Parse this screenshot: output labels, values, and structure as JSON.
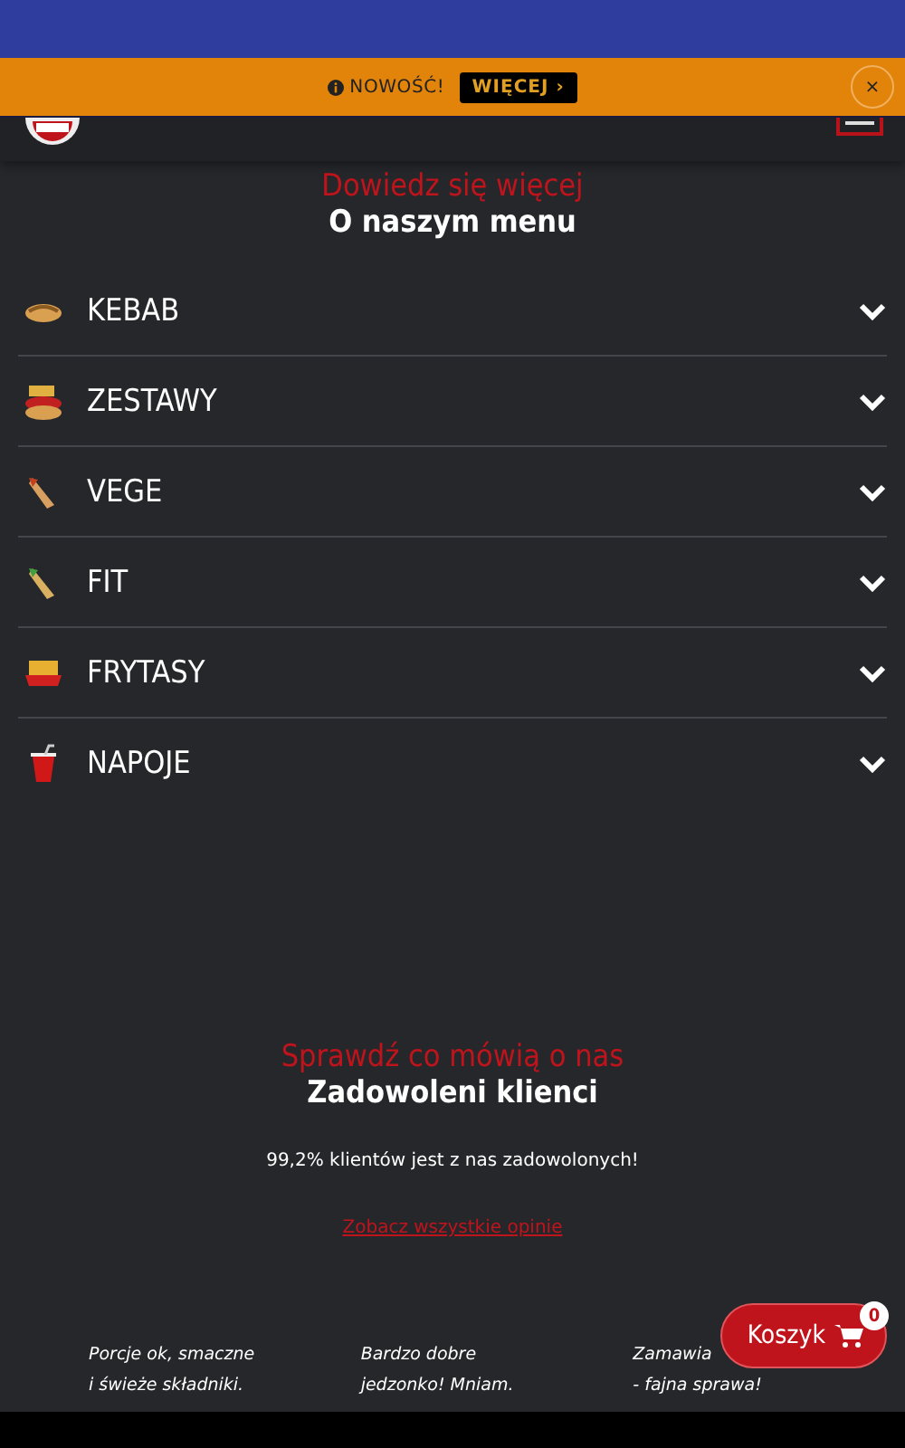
{
  "banner": {
    "label": "NOWOŚĆ!",
    "button": "WIĘCEJ ›",
    "close": "×"
  },
  "menu_section": {
    "subtitle": "Dowiedz się więcej",
    "title": "O naszym menu",
    "items": [
      {
        "label": "KEBAB",
        "kind": "kebab",
        "expanded": false
      },
      {
        "label": "ZESTAWY",
        "kind": "set",
        "expanded": false
      },
      {
        "label": "VEGE",
        "kind": "wrap",
        "expanded": false
      },
      {
        "label": "FIT",
        "kind": "wrapgreen",
        "expanded": false
      },
      {
        "label": "FRYTASY",
        "kind": "fries",
        "expanded": false
      },
      {
        "label": "NAPOJE",
        "kind": "drink",
        "expanded": false
      }
    ]
  },
  "reviews_section": {
    "subtitle": "Sprawdź co mówią o nas",
    "title": "Zadowoleni klienci",
    "summary": "99,2% klientów jest z nas zadowolonych!",
    "link": "Zobacz wszystkie opinie",
    "reviews": [
      [
        "Porcje ok, smaczne",
        "i świeże składniki."
      ],
      [
        "Bardzo dobre",
        "jedzonko! Mniam."
      ],
      [
        "Zamawia",
        "- fajna sprawa!"
      ]
    ]
  },
  "cart": {
    "label": "Koszyk",
    "count": "0"
  }
}
